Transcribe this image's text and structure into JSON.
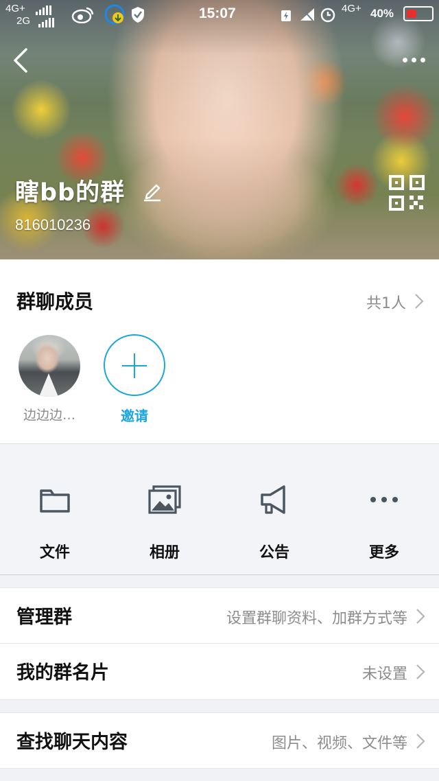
{
  "status_bar": {
    "network_top": "4G+",
    "network_bottom": "2G",
    "time": "15:07",
    "network_right": "4G+",
    "battery": "40%"
  },
  "header": {
    "group_name": "瞎bb的群",
    "group_id": "816010236",
    "icons": [
      "back-icon",
      "more-icon",
      "edit-icon",
      "qrcode-icon"
    ]
  },
  "members": {
    "title": "群聊成员",
    "count": "共1人",
    "list": [
      {
        "name": "边边边…"
      }
    ],
    "invite_label": "邀请"
  },
  "actions": [
    {
      "label": "文件",
      "icon": "folder-icon"
    },
    {
      "label": "相册",
      "icon": "album-icon"
    },
    {
      "label": "公告",
      "icon": "megaphone-icon"
    },
    {
      "label": "更多",
      "icon": "more-dots-icon"
    }
  ],
  "rows": [
    {
      "title": "管理群",
      "value": "设置群聊资料、加群方式等"
    },
    {
      "title": "我的群名片",
      "value": "未设置"
    },
    {
      "title": "查找聊天内容",
      "value": "图片、视频、文件等"
    }
  ],
  "colors": {
    "accent": "#1ba6e0",
    "secondary_text": "#8c8c8c",
    "background": "#f1f2f6"
  }
}
